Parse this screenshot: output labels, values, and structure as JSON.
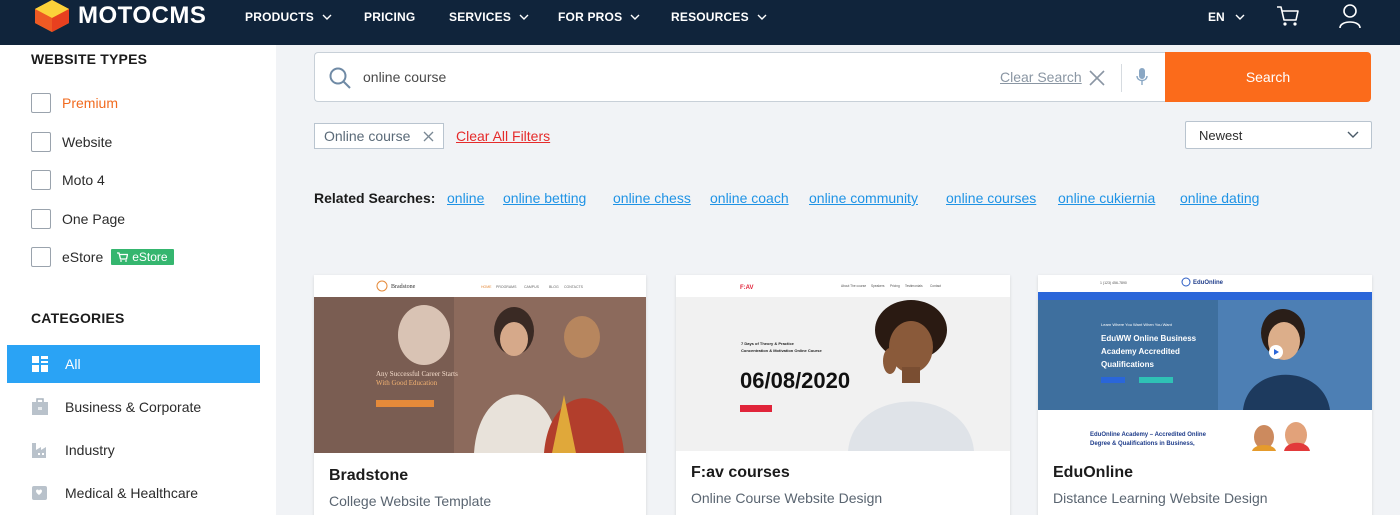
{
  "brand": {
    "name": "MOTOCMS",
    "colors": {
      "orange": "#fb6b1b",
      "navy": "#10243b",
      "blue": "#2aa3f5",
      "green": "#35b66f"
    }
  },
  "nav": {
    "items": [
      {
        "label": "PRODUCTS",
        "has_dropdown": true
      },
      {
        "label": "PRICING",
        "has_dropdown": false
      },
      {
        "label": "SERVICES",
        "has_dropdown": true
      },
      {
        "label": "FOR PROS",
        "has_dropdown": true
      },
      {
        "label": "RESOURCES",
        "has_dropdown": true
      }
    ],
    "language": "EN",
    "icons": [
      "cart-icon",
      "user-icon"
    ]
  },
  "sidebar": {
    "website_types_title": "WEBSITE TYPES",
    "types": [
      {
        "label": "Premium"
      },
      {
        "label": "Website"
      },
      {
        "label": "Moto 4"
      },
      {
        "label": "One Page"
      },
      {
        "label": "eStore",
        "badge": "eStore"
      }
    ],
    "categories_title": "CATEGORIES",
    "categories": [
      {
        "label": "All",
        "active": true,
        "icon": "grid-icon"
      },
      {
        "label": "Business & Corporate",
        "icon": "briefcase-icon"
      },
      {
        "label": "Industry",
        "icon": "factory-icon"
      },
      {
        "label": "Medical & Healthcare",
        "icon": "medical-icon"
      }
    ]
  },
  "search": {
    "value": "online course",
    "clear_label": "Clear Search",
    "button_label": "Search"
  },
  "filters": {
    "active_chip": "Online course",
    "clear_all_label": "Clear All Filters",
    "sort_value": "Newest"
  },
  "related": {
    "label": "Related Searches:",
    "links": [
      "online",
      "online betting",
      "online chess",
      "online coach",
      "online community",
      "online courses",
      "online cukiernia",
      "online dating"
    ]
  },
  "cards": [
    {
      "title": "Bradstone",
      "subtitle": "College Website Template",
      "preview": {
        "logo": "Bradstone",
        "menu": [
          "HOME",
          "PROGRAMS",
          "CAMPUS",
          "BLOG",
          "CONTACTS"
        ],
        "line1": "Any Successful Career Starts",
        "line2": "With Good Education"
      }
    },
    {
      "title": "F:av courses",
      "subtitle": "Online Course Website Design",
      "preview": {
        "logo": "F:AV",
        "menu": [
          "About The course",
          "Speakers",
          "Pricing",
          "Testimonials",
          "Contact"
        ],
        "line1": "7 Days of Theory & Practice",
        "line2": "Concentration & Motivation Online Course",
        "date": "06/08/2020"
      }
    },
    {
      "title": "EduOnline",
      "subtitle": "Distance Learning Website Design",
      "preview": {
        "logo": "EduOnline",
        "kicker": "Learn Where You Want When You Want",
        "headline": [
          "EduWW Online Business",
          "Academy Accredited",
          "Qualifications"
        ],
        "lower": [
          "EduOnline Academy – Accredited Online",
          "Degree & Qualifications in Business,"
        ]
      }
    }
  ]
}
